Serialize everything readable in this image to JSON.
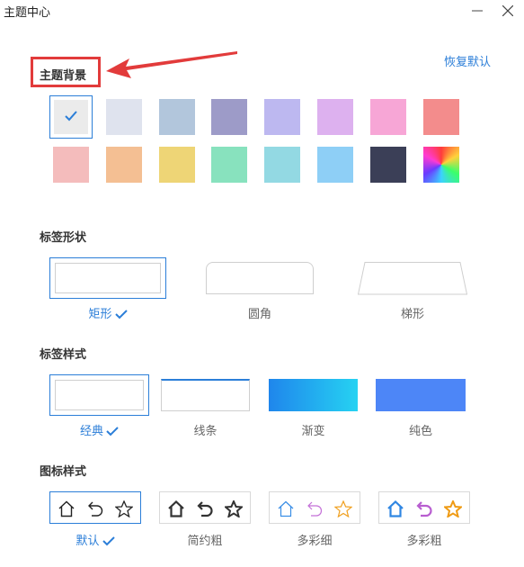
{
  "window": {
    "title": "主题中心"
  },
  "header": {
    "restore_label": "恢复默认"
  },
  "background_section": {
    "title": "主题背景",
    "swatches": [
      {
        "color": "#ebebeb",
        "selected": true
      },
      {
        "color": "#dfe3ee"
      },
      {
        "color": "#b2c6dc"
      },
      {
        "color": "#9d9bc8"
      },
      {
        "color": "#bdb8f0"
      },
      {
        "color": "#ddb1ef"
      },
      {
        "color": "#f7a6d6"
      },
      {
        "color": "#f38c8c"
      },
      {
        "color": "#f4bcbc"
      },
      {
        "color": "#f4bf93"
      },
      {
        "color": "#eed576"
      },
      {
        "color": "#88e2be"
      },
      {
        "color": "#93d9e3"
      },
      {
        "color": "#8ecff6"
      },
      {
        "color": "#3b3f57"
      },
      {
        "color": "gradient-rainbow"
      }
    ]
  },
  "tab_shape_section": {
    "title": "标签形状",
    "options": [
      {
        "label": "矩形",
        "selected": true
      },
      {
        "label": "圆角"
      },
      {
        "label": "梯形"
      }
    ]
  },
  "tab_style_section": {
    "title": "标签样式",
    "options": [
      {
        "label": "经典",
        "selected": true
      },
      {
        "label": "线条"
      },
      {
        "label": "渐变"
      },
      {
        "label": "纯色"
      }
    ]
  },
  "icon_style_section": {
    "title": "图标样式",
    "options": [
      {
        "label": "默认",
        "selected": true,
        "icons": [
          "home-icon",
          "undo-icon",
          "star-icon"
        ]
      },
      {
        "label": "简约粗",
        "icons": [
          "home-icon",
          "undo-icon",
          "star-icon"
        ]
      },
      {
        "label": "多彩细",
        "icons": [
          "home-icon",
          "undo-icon",
          "star-icon"
        ]
      },
      {
        "label": "多彩粗",
        "icons": [
          "home-icon",
          "undo-icon",
          "star-icon"
        ]
      }
    ]
  },
  "colors": {
    "accent": "#2b7ed8",
    "annotation": "#e23b3b"
  }
}
